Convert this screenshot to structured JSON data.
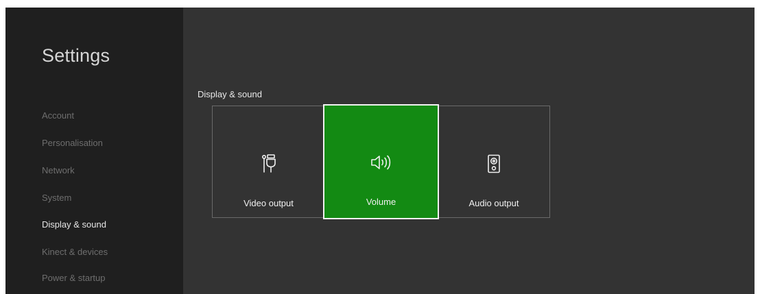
{
  "sidebar": {
    "title": "Settings",
    "items": [
      {
        "label": "Account"
      },
      {
        "label": "Personalisation"
      },
      {
        "label": "Network"
      },
      {
        "label": "System"
      },
      {
        "label": "Display & sound",
        "active": true
      },
      {
        "label": "Kinect & devices"
      },
      {
        "label": "Power & startup"
      }
    ]
  },
  "main": {
    "section_title": "Display & sound",
    "tiles": [
      {
        "label": "Video output",
        "icon": "video-connector-icon"
      },
      {
        "label": "Volume",
        "icon": "speaker-volume-icon",
        "selected": true
      },
      {
        "label": "Audio output",
        "icon": "speaker-box-icon"
      }
    ]
  },
  "colors": {
    "background": "#333333",
    "sidebar": "#1f1f1f",
    "accent": "#138a13",
    "focus_border": "#f2f2f2"
  }
}
